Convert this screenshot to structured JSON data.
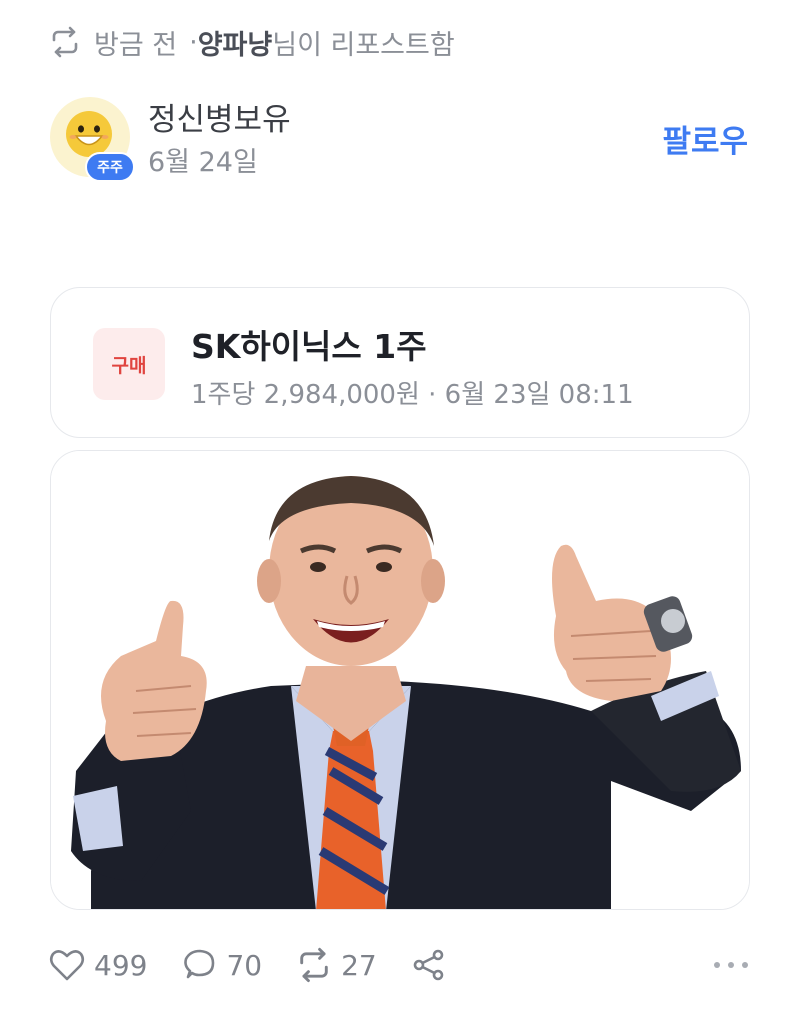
{
  "repost": {
    "time": "방금 전",
    "separator": "·",
    "user": "양파냥",
    "suffix": "님이 리포스트함",
    "icon": "repost-icon"
  },
  "author": {
    "name": "정신병보유",
    "date": "6월 24일",
    "badge": "주주",
    "follow_label": "팔로우"
  },
  "trade": {
    "tag": "구매",
    "title": "SK하이닉스 1주",
    "detail": "1주당 2,984,000원 · 6월 23일 08:11"
  },
  "image": {
    "description_icon": "thumbs-up-businessman-photo"
  },
  "actions": {
    "likes": "499",
    "comments": "70",
    "reposts": "27",
    "icons": [
      "heart-icon",
      "comment-icon",
      "repost-icon",
      "share-icon",
      "more-icon"
    ]
  },
  "colors": {
    "accent": "#3e7bf2",
    "buy_tag_text": "#e0443f",
    "buy_tag_bg": "#fdecec",
    "muted_text": "#8b8f97"
  }
}
